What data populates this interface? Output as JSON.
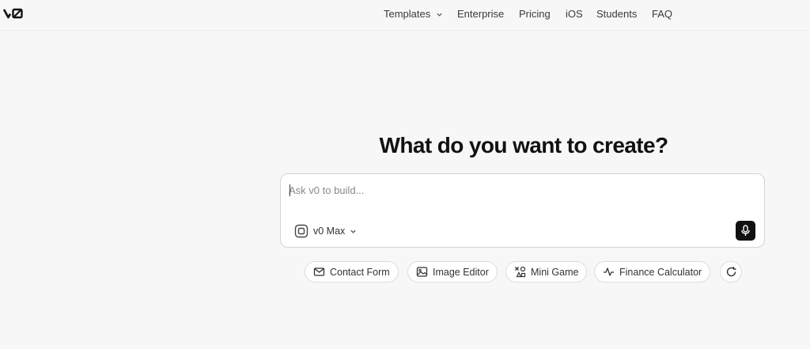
{
  "brand": {
    "logo_text": "v0"
  },
  "nav": {
    "items": [
      {
        "label": "Templates",
        "has_dropdown": true
      },
      {
        "label": "Enterprise"
      },
      {
        "label": "Pricing"
      },
      {
        "label": "iOS"
      },
      {
        "label": "Students"
      },
      {
        "label": "FAQ"
      }
    ]
  },
  "main": {
    "headline": "What do you want to create?",
    "prompt": {
      "placeholder": "Ask v0 to build...",
      "value": "",
      "model_label": "v0 Max",
      "mic_icon": "microphone-icon"
    },
    "suggestions": [
      {
        "label": "Contact Form",
        "icon": "envelope-icon"
      },
      {
        "label": "Image Editor",
        "icon": "image-icon"
      },
      {
        "label": "Mini Game",
        "icon": "shapes-icon"
      },
      {
        "label": "Finance Calculator",
        "icon": "activity-icon"
      }
    ],
    "refresh_icon": "refresh-icon"
  },
  "colors": {
    "background": "#f7f7f7",
    "mic_button": "#111111",
    "border": "#d4d4d4"
  }
}
